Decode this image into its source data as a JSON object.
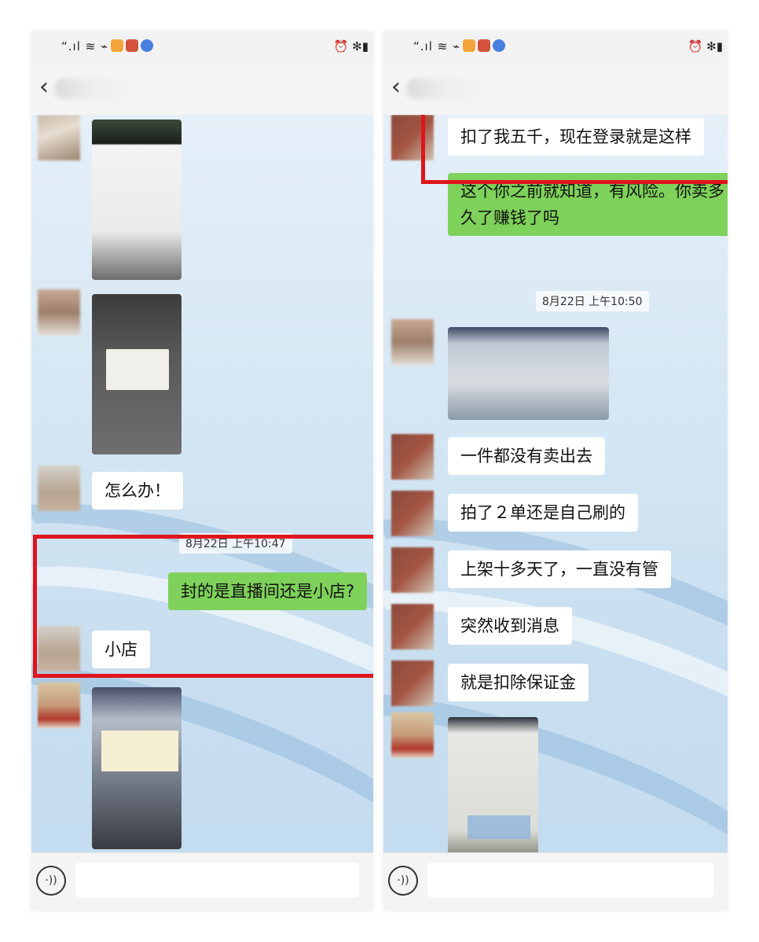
{
  "colors": {
    "highlight": "#e0141c",
    "bubble_in": "#ffffff",
    "bubble_out": "#7ed15a"
  },
  "status_icons": [
    "signal-icon",
    "wifi-icon",
    "alarm-icon",
    "battery-icon"
  ],
  "left_screen": {
    "back_icon": "‹",
    "messages": [
      {
        "kind": "image",
        "from": "other",
        "content": "phone-screenshot-photo"
      },
      {
        "kind": "image",
        "from": "other",
        "content": "phone-dialog-photo"
      },
      {
        "kind": "text",
        "from": "other",
        "text": "怎么办！"
      },
      {
        "kind": "time",
        "text": "8月22日 上午10:47"
      },
      {
        "kind": "text",
        "from": "me",
        "text": "封的是直播间还是小店?"
      },
      {
        "kind": "text",
        "from": "other",
        "text": "小店"
      },
      {
        "kind": "image",
        "from": "other",
        "content": "laptop-screen-photo"
      }
    ]
  },
  "right_screen": {
    "back_icon": "‹",
    "messages": [
      {
        "kind": "text",
        "from": "other",
        "text": "扣了我五千，现在登录就是这样"
      },
      {
        "kind": "text",
        "from": "me",
        "text": "这个你之前就知道，有风险。你卖多久了赚钱了吗"
      },
      {
        "kind": "time",
        "text": "8月22日 上午10:50"
      },
      {
        "kind": "image",
        "from": "other",
        "content": "screen-photo"
      },
      {
        "kind": "text",
        "from": "other",
        "text": "一件都没有卖出去"
      },
      {
        "kind": "text",
        "from": "other",
        "text": "拍了２单还是自己刷的"
      },
      {
        "kind": "text",
        "from": "other",
        "text": "上架十多天了，一直没有管"
      },
      {
        "kind": "text",
        "from": "other",
        "text": "突然收到消息"
      },
      {
        "kind": "text",
        "from": "other",
        "text": "就是扣除保证金"
      },
      {
        "kind": "image",
        "from": "other",
        "content": "laptop-screen-photo"
      }
    ]
  }
}
